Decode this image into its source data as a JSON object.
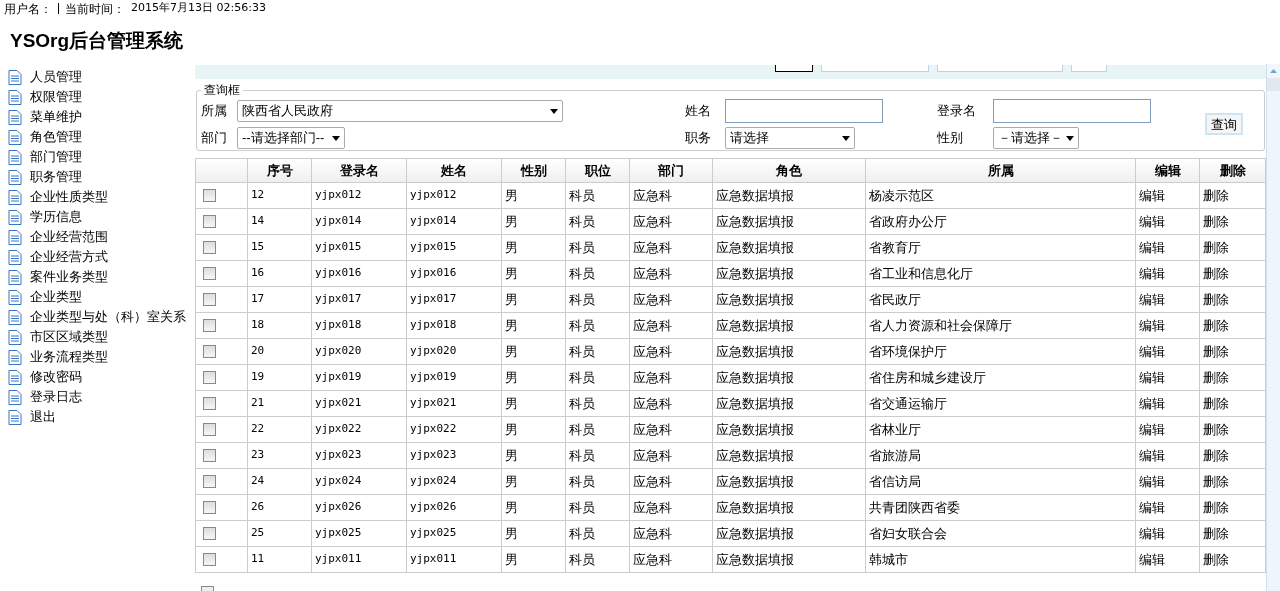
{
  "header": {
    "user_label": "用户名：",
    "time_label": "当前时间：",
    "time": "2015年7月13日 02:56:33"
  },
  "title": "YSOrg后台管理系统",
  "sidebar": {
    "items": [
      "人员管理",
      "权限管理",
      "菜单维护",
      "角色管理",
      "部门管理",
      "职务管理",
      "企业性质类型",
      "学历信息",
      "企业经营范围",
      "企业经营方式",
      "案件业务类型",
      "企业类型",
      "企业类型与处（科）室关系",
      "市区区域类型",
      "业务流程类型",
      "修改密码",
      "登录日志",
      "退出"
    ]
  },
  "query": {
    "legend": "查询框",
    "fields": [
      {
        "label": "所属",
        "kind": "select",
        "value": "陕西省人民政府"
      },
      {
        "label": "姓名",
        "kind": "input"
      },
      {
        "label": "登录名",
        "kind": "input"
      },
      {
        "label": "部门",
        "kind": "select",
        "value": "--请选择部门--"
      },
      {
        "label": "职务",
        "kind": "select",
        "value": "请选择"
      },
      {
        "label": "性别",
        "kind": "select",
        "value": "－请选择－"
      }
    ],
    "button": "查询"
  },
  "select_all": {
    "checked": false
  },
  "table": {
    "columns": [
      "序号",
      "登录名",
      "姓名",
      "性别",
      "职位",
      "部门",
      "角色",
      "所属",
      "编辑",
      "删除"
    ],
    "rows": [
      {
        "checked": false,
        "cells": [
          "12",
          "yjpx012",
          "yjpx012",
          "男",
          "科员",
          "应急科",
          "应急数据填报",
          "杨凌示范区",
          "编辑",
          "删除"
        ]
      },
      {
        "checked": false,
        "cells": [
          "14",
          "yjpx014",
          "yjpx014",
          "男",
          "科员",
          "应急科",
          "应急数据填报",
          "省政府办公厅",
          "编辑",
          "删除"
        ]
      },
      {
        "checked": false,
        "cells": [
          "15",
          "yjpx015",
          "yjpx015",
          "男",
          "科员",
          "应急科",
          "应急数据填报",
          "省教育厅",
          "编辑",
          "删除"
        ]
      },
      {
        "checked": false,
        "cells": [
          "16",
          "yjpx016",
          "yjpx016",
          "男",
          "科员",
          "应急科",
          "应急数据填报",
          "省工业和信息化厅",
          "编辑",
          "删除"
        ]
      },
      {
        "checked": false,
        "cells": [
          "17",
          "yjpx017",
          "yjpx017",
          "男",
          "科员",
          "应急科",
          "应急数据填报",
          "省民政厅",
          "编辑",
          "删除"
        ]
      },
      {
        "checked": false,
        "cells": [
          "18",
          "yjpx018",
          "yjpx018",
          "男",
          "科员",
          "应急科",
          "应急数据填报",
          "省人力资源和社会保障厅",
          "编辑",
          "删除"
        ]
      },
      {
        "checked": false,
        "cells": [
          "20",
          "yjpx020",
          "yjpx020",
          "男",
          "科员",
          "应急科",
          "应急数据填报",
          "省环境保护厅",
          "编辑",
          "删除"
        ]
      },
      {
        "checked": false,
        "cells": [
          "19",
          "yjpx019",
          "yjpx019",
          "男",
          "科员",
          "应急科",
          "应急数据填报",
          "省住房和城乡建设厅",
          "编辑",
          "删除"
        ]
      },
      {
        "checked": false,
        "cells": [
          "21",
          "yjpx021",
          "yjpx021",
          "男",
          "科员",
          "应急科",
          "应急数据填报",
          "省交通运输厅",
          "编辑",
          "删除"
        ]
      },
      {
        "checked": false,
        "cells": [
          "22",
          "yjpx022",
          "yjpx022",
          "男",
          "科员",
          "应急科",
          "应急数据填报",
          "省林业厅",
          "编辑",
          "删除"
        ]
      },
      {
        "checked": false,
        "cells": [
          "23",
          "yjpx023",
          "yjpx023",
          "男",
          "科员",
          "应急科",
          "应急数据填报",
          "省旅游局",
          "编辑",
          "删除"
        ]
      },
      {
        "checked": false,
        "cells": [
          "24",
          "yjpx024",
          "yjpx024",
          "男",
          "科员",
          "应急科",
          "应急数据填报",
          "省信访局",
          "编辑",
          "删除"
        ]
      },
      {
        "checked": false,
        "cells": [
          "26",
          "yjpx026",
          "yjpx026",
          "男",
          "科员",
          "应急科",
          "应急数据填报",
          "共青团陕西省委",
          "编辑",
          "删除"
        ]
      },
      {
        "checked": false,
        "cells": [
          "25",
          "yjpx025",
          "yjpx025",
          "男",
          "科员",
          "应急科",
          "应急数据填报",
          "省妇女联合会",
          "编辑",
          "删除"
        ]
      },
      {
        "checked": false,
        "cells": [
          "11",
          "yjpx011",
          "yjpx011",
          "男",
          "科员",
          "应急科",
          "应急数据填报",
          "韩城市",
          "编辑",
          "删除"
        ]
      }
    ]
  }
}
